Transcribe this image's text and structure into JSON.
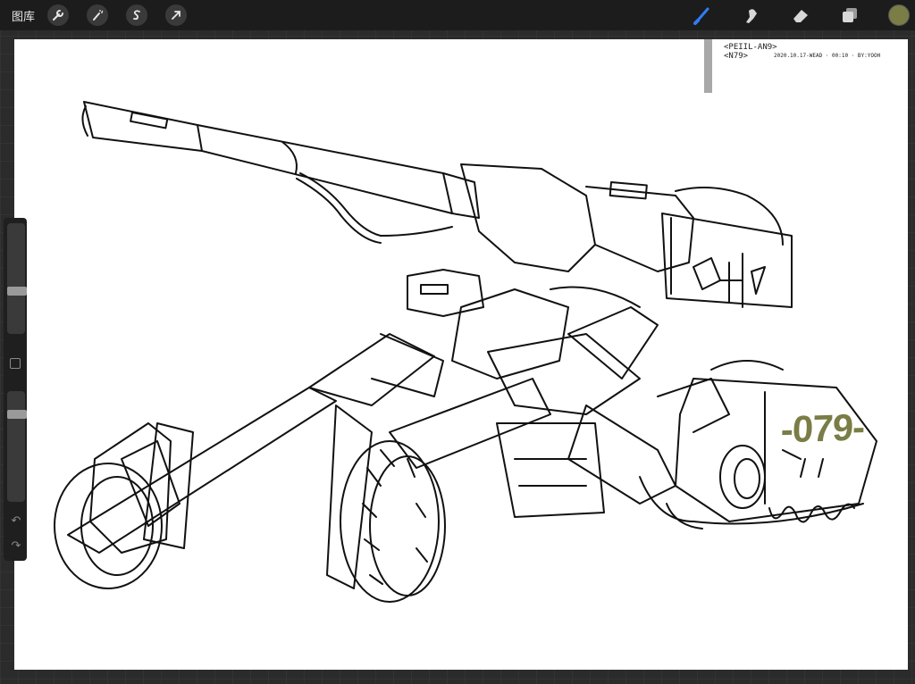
{
  "topbar": {
    "gallery_label": "图库",
    "tools_left": [
      {
        "name": "actions",
        "icon": "wrench-icon"
      },
      {
        "name": "adjustments",
        "icon": "magic-wand-icon"
      },
      {
        "name": "selection",
        "icon": "selection-s-icon"
      },
      {
        "name": "transform",
        "icon": "arrow-cursor-icon"
      }
    ],
    "tools_right": [
      {
        "name": "brush",
        "icon": "brush-icon",
        "active": true
      },
      {
        "name": "smudge",
        "icon": "smudge-finger-icon"
      },
      {
        "name": "eraser",
        "icon": "eraser-icon"
      },
      {
        "name": "layers",
        "icon": "layers-icon"
      }
    ],
    "current_color": "#7a7d45"
  },
  "sidebar": {
    "brush_size_level": 0.62,
    "opacity_level": 0.82,
    "undo_icon": "undo-icon",
    "redo_icon": "redo-icon",
    "modify_icon": "square-modify-icon"
  },
  "canvas": {
    "signature_line1": "<PEIIL-AN9>",
    "signature_line2": "<N79>",
    "signature_line3": "2020.10.17-WEAD · 00:10 · BY:YOOH",
    "vehicle_number": "-079-"
  },
  "colors": {
    "accent_blue": "#2f7cf6",
    "ui_dark": "#1c1c1c",
    "number_paint": "#7a7d45"
  }
}
